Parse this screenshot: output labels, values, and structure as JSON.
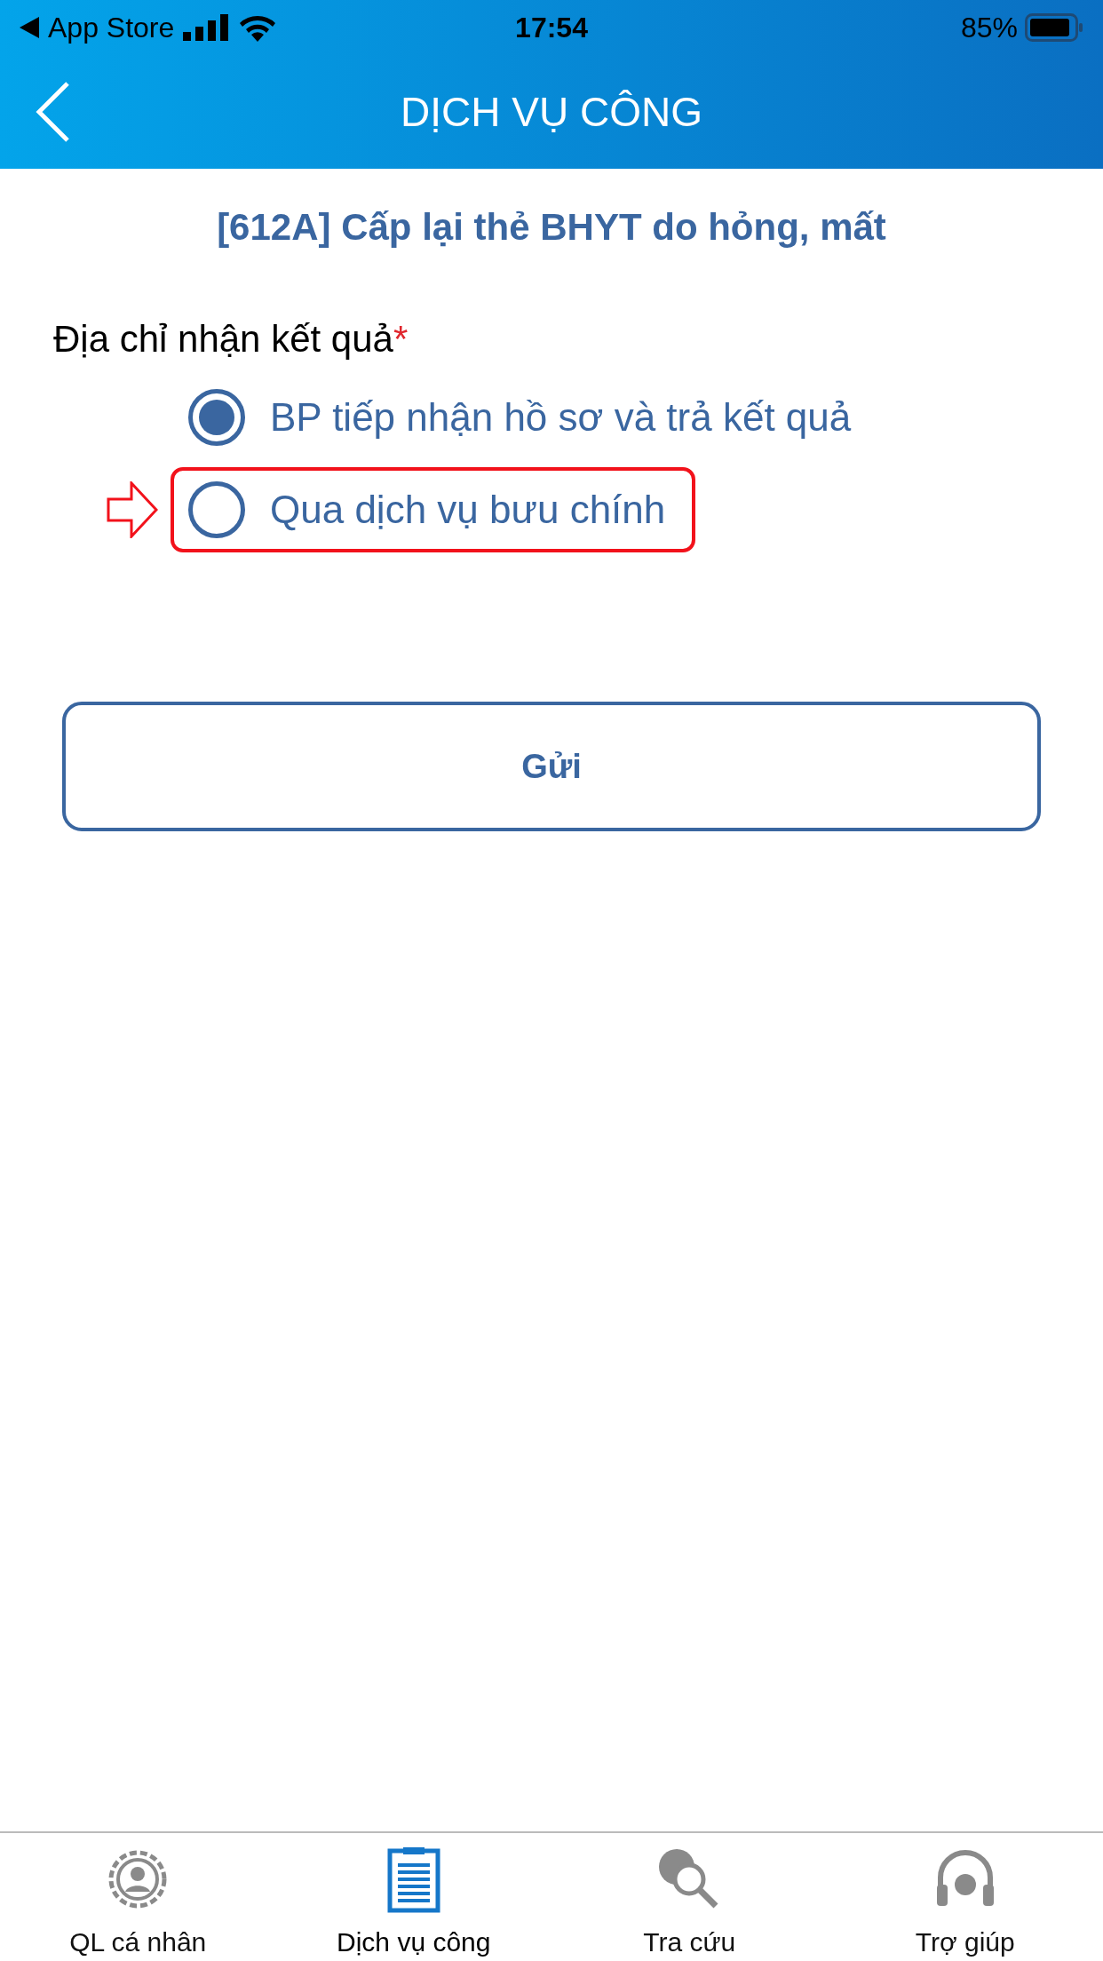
{
  "status_bar": {
    "back_app": "App Store",
    "time": "17:54",
    "battery": "85%"
  },
  "header": {
    "title": "DỊCH VỤ CÔNG"
  },
  "form": {
    "title": "[612A] Cấp lại thẻ BHYT do hỏng, mất",
    "field_label": "Địa chỉ nhận kết quả",
    "required_mark": "*",
    "options": [
      {
        "label": "BP tiếp nhận hồ sơ và trả kết quả",
        "selected": true,
        "highlighted": false
      },
      {
        "label": "Qua dịch vụ bưu chính",
        "selected": false,
        "highlighted": true
      }
    ],
    "submit": "Gửi"
  },
  "tab_bar": [
    {
      "label": "QL cá nhân",
      "kind": "profile",
      "selected": false
    },
    {
      "label": "Dịch vụ công",
      "kind": "services",
      "selected": true
    },
    {
      "label": "Tra cứu",
      "kind": "lookup",
      "selected": false
    },
    {
      "label": "Trợ giúp",
      "kind": "help",
      "selected": false
    }
  ]
}
